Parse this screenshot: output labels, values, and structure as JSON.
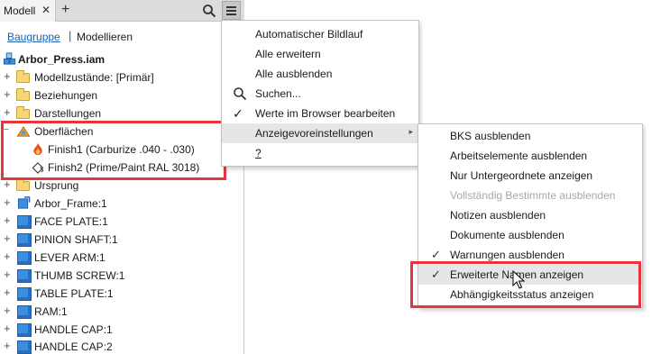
{
  "colors": {
    "highlight_box": "#e8353b",
    "link_blue": "#1a5fb4",
    "part_cube": "#3a8fe0",
    "folder": "#f7d774",
    "menu_hover": "#e6e6e6"
  },
  "tabbar": {
    "tab_label": "Modell",
    "close_glyph": "✕",
    "add_glyph": "+",
    "search_icon": "search-icon",
    "menu_icon": "hamburger-menu-icon"
  },
  "modebar": {
    "assembly": "Baugruppe",
    "separator": "|",
    "modeling": "Modellieren"
  },
  "tree": {
    "root": "Arbor_Press.iam",
    "nodes": [
      {
        "label": "Modellzustände: [Primär]",
        "icon": "model-states-icon"
      },
      {
        "label": "Beziehungen",
        "icon": "folder-icon"
      },
      {
        "label": "Darstellungen",
        "icon": "folder-icon"
      },
      {
        "label": "Oberflächen",
        "icon": "appearance-icon"
      },
      {
        "label": "Finish1 (Carburize .040 - .030)",
        "icon": "flame-icon"
      },
      {
        "label": "Finish2 (Prime/Paint RAL 3018)",
        "icon": "paint-icon"
      },
      {
        "label": "Ursprung",
        "icon": "folder-icon"
      },
      {
        "label": "Arbor_Frame:1",
        "icon": "part-grounded-icon"
      },
      {
        "label": "FACE PLATE:1",
        "icon": "part-icon"
      },
      {
        "label": "PINION SHAFT:1",
        "icon": "part-icon"
      },
      {
        "label": "LEVER ARM:1",
        "icon": "part-icon"
      },
      {
        "label": "THUMB SCREW:1",
        "icon": "part-icon"
      },
      {
        "label": "TABLE PLATE:1",
        "icon": "part-icon"
      },
      {
        "label": "RAM:1",
        "icon": "part-icon"
      },
      {
        "label": "HANDLE CAP:1",
        "icon": "part-icon"
      },
      {
        "label": "HANDLE CAP:2",
        "icon": "part-icon"
      }
    ]
  },
  "menu1": {
    "items": [
      {
        "label": "Automatischer Bildlauf",
        "icon": ""
      },
      {
        "label": "Alle erweitern",
        "icon": ""
      },
      {
        "label": "Alle ausblenden",
        "icon": ""
      },
      {
        "label": "Suchen...",
        "icon": "search-icon"
      },
      {
        "label": "Werte im Browser bearbeiten",
        "icon": "check-icon"
      },
      {
        "label": "Anzeigevoreinstellungen",
        "icon": "",
        "submenu": true,
        "highlighted": true
      },
      {
        "label": "?",
        "icon": ""
      }
    ]
  },
  "menu2": {
    "items": [
      {
        "label": "BKS ausblenden",
        "checked": false,
        "disabled": false
      },
      {
        "label": "Arbeitselemente ausblenden",
        "checked": false,
        "disabled": false
      },
      {
        "label": "Nur Untergeordnete anzeigen",
        "checked": false,
        "disabled": false
      },
      {
        "label": "Vollständig Bestimmte ausblenden",
        "checked": false,
        "disabled": true
      },
      {
        "label": "Notizen ausblenden",
        "checked": false,
        "disabled": false
      },
      {
        "label": "Dokumente ausblenden",
        "checked": false,
        "disabled": false
      },
      {
        "label": "Warnungen ausblenden",
        "checked": true,
        "disabled": false
      },
      {
        "label": "Erweiterte Namen anzeigen",
        "checked": true,
        "disabled": false,
        "highlighted": true
      },
      {
        "label": "Abhängigkeitsstatus anzeigen",
        "checked": false,
        "disabled": false
      }
    ]
  },
  "check_glyph": "✓",
  "submenu_arrow": "▸"
}
